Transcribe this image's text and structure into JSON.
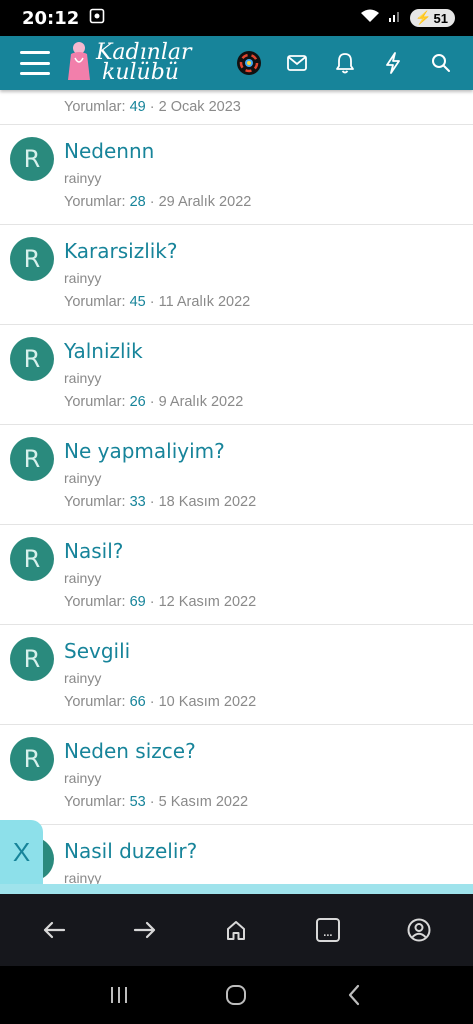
{
  "status": {
    "time": "20:12",
    "battery": "51"
  },
  "header": {
    "logo_line1": "Kadınlar",
    "logo_line2": "kulübü"
  },
  "colors": {
    "accent": "#17849a",
    "avatar": "#2a8a7d",
    "panel": "#8de0ea"
  },
  "top_item": {
    "label": "Yorumlar:",
    "count": "49",
    "sep": "·",
    "date": "2 Ocak 2023"
  },
  "items": [
    {
      "avatar": "R",
      "title": "Nedennn",
      "author": "rainyy",
      "label": "Yorumlar:",
      "count": "28",
      "sep": "·",
      "date": "29 Aralık 2022"
    },
    {
      "avatar": "R",
      "title": "Kararsizlik?",
      "author": "rainyy",
      "label": "Yorumlar:",
      "count": "45",
      "sep": "·",
      "date": "11 Aralık 2022"
    },
    {
      "avatar": "R",
      "title": "Yalnizlik",
      "author": "rainyy",
      "label": "Yorumlar:",
      "count": "26",
      "sep": "·",
      "date": "9 Aralık 2022"
    },
    {
      "avatar": "R",
      "title": "Ne yapmaliyim?",
      "author": "rainyy",
      "label": "Yorumlar:",
      "count": "33",
      "sep": "·",
      "date": "18 Kasım 2022"
    },
    {
      "avatar": "R",
      "title": "Nasil?",
      "author": "rainyy",
      "label": "Yorumlar:",
      "count": "69",
      "sep": "·",
      "date": "12 Kasım 2022"
    },
    {
      "avatar": "R",
      "title": "Sevgili",
      "author": "rainyy",
      "label": "Yorumlar:",
      "count": "66",
      "sep": "·",
      "date": "10 Kasım 2022"
    },
    {
      "avatar": "R",
      "title": "Neden sizce?",
      "author": "rainyy",
      "label": "Yorumlar:",
      "count": "53",
      "sep": "·",
      "date": "5 Kasım 2022"
    },
    {
      "avatar": "R",
      "title": "Nasil duzelir?",
      "author": "rainyy"
    }
  ],
  "close_tab": {
    "label": "X"
  },
  "browser_nav": {
    "tabs_label": "..."
  }
}
